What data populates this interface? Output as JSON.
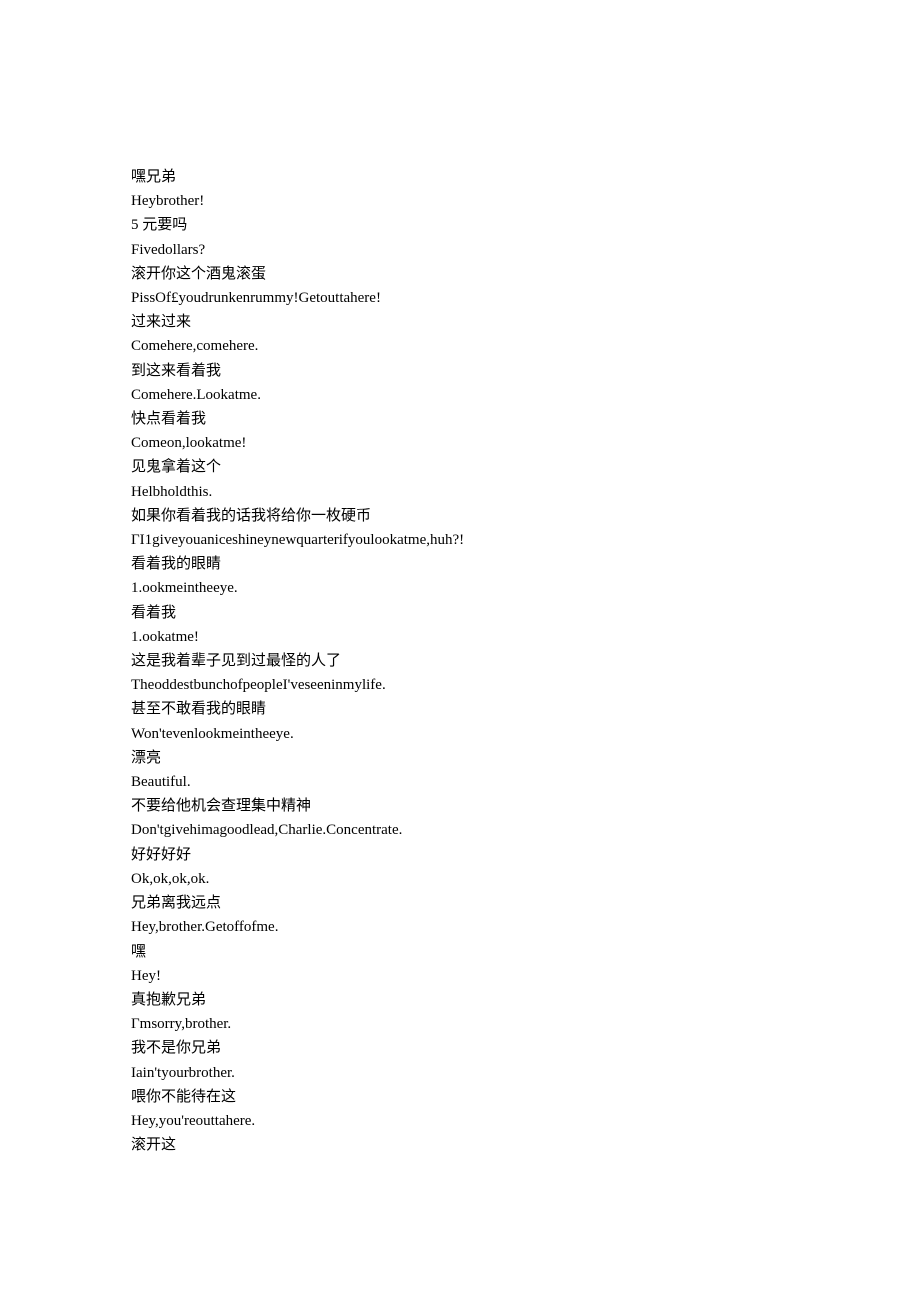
{
  "lines": [
    "嘿兄弟",
    "Heybrother!",
    "5 元要吗",
    "Fivedollars?",
    "滚开你这个酒鬼滚蛋",
    "PissOf£youdrunkenrummy!Getouttahere!",
    "过来过来",
    "Comehere,comehere.",
    "到这来看着我",
    "Comehere.Lookatme.",
    "快点看着我",
    "Comeon,lookatme!",
    "见鬼拿着这个",
    "Helbholdthis.",
    "如果你看着我的话我将给你一枚硬币",
    "ΓI1giveyouaniceshineynewquarterifyoulookatme,huh?!",
    "看着我的眼睛",
    "1.ookmeintheeye.",
    "看着我",
    "1.ookatme!",
    "这是我着辈子见到过最怪的人了",
    "TheoddestbunchofpeopleI'veseeninmylife.",
    "甚至不敢看我的眼睛",
    "Won'tevenlookmeintheeye.",
    "漂亮",
    "Beautiful.",
    "不要给他机会查理集中精神",
    "Don'tgivehimagoodlead,Charlie.Concentrate.",
    "好好好好",
    "Ok,ok,ok,ok.",
    "兄弟离我远点",
    "Hey,brother.Getoffofme.",
    "嘿",
    "Hey!",
    "真抱歉兄弟",
    "Γmsorry,brother.",
    "我不是你兄弟",
    "Iain'tyourbrother.",
    "喂你不能待在这",
    "Hey,you'reouttahere.",
    "滚开这"
  ]
}
